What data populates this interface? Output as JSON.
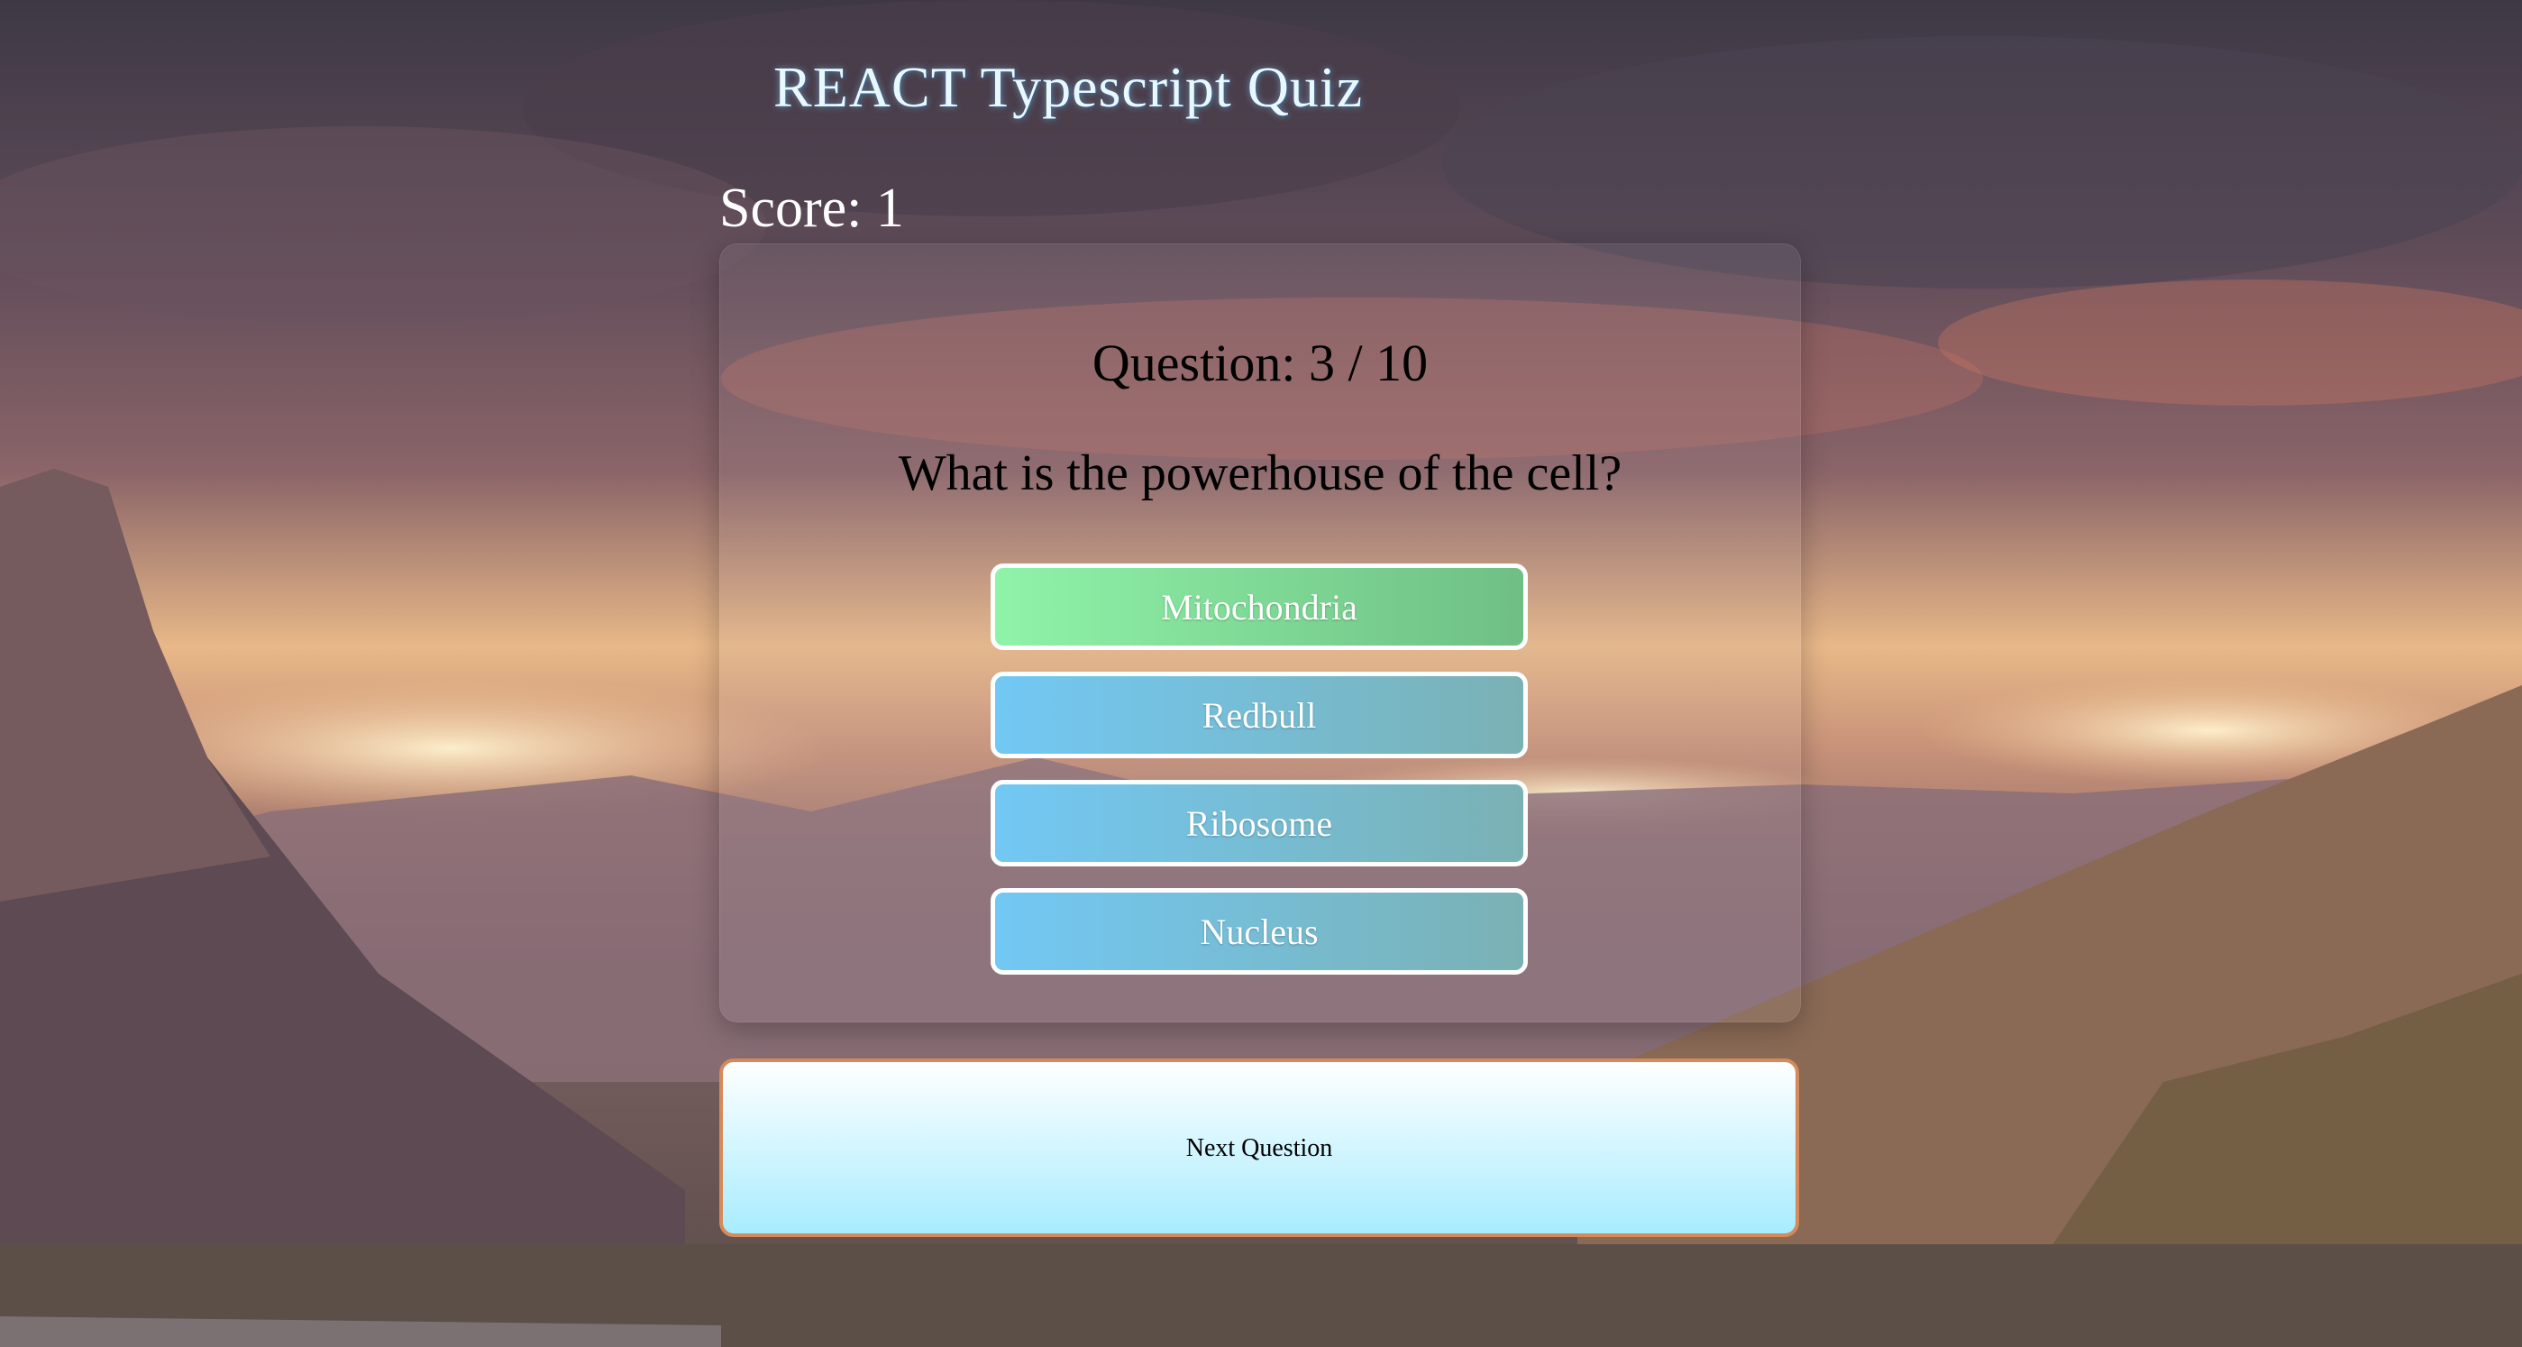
{
  "app": {
    "title": "REACT Typescript Quiz"
  },
  "score": {
    "label": "Score: 1",
    "value": 1
  },
  "question": {
    "number_label": "Question: 3 / 10",
    "current": 3,
    "total": 10,
    "text": "What is the powerhouse of the cell?"
  },
  "answers": [
    {
      "label": "Mitochondria",
      "state": "correct"
    },
    {
      "label": "Redbull",
      "state": "default"
    },
    {
      "label": "Ribosome",
      "state": "default"
    },
    {
      "label": "Nucleus",
      "state": "default"
    }
  ],
  "controls": {
    "next_label": "Next Question"
  },
  "colors": {
    "correct_answer": "#8ff3a8",
    "default_answer": "#72c8f4",
    "next_border": "#d48a5a",
    "title_text": "#e8f8ff"
  }
}
